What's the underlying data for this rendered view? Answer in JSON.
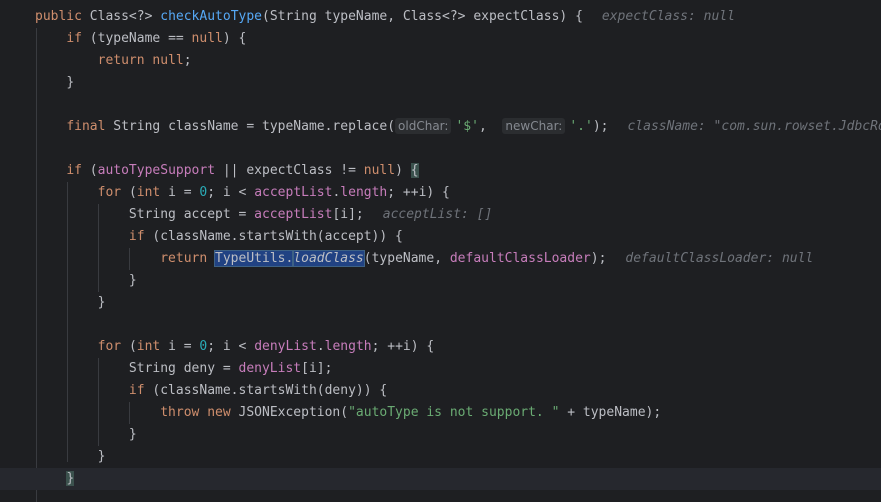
{
  "lines": [
    {
      "indent": "",
      "tokens": [
        {
          "t": "public ",
          "c": "kw"
        },
        {
          "t": "Class<?> ",
          "c": ""
        },
        {
          "t": "checkAutoType",
          "c": "fn"
        },
        {
          "t": "(String typeName, Class<?> expectClass) {",
          "c": ""
        }
      ],
      "hint": "expectClass: null"
    },
    {
      "indent": "    ",
      "tokens": [
        {
          "t": "if ",
          "c": "kw"
        },
        {
          "t": "(typeName == ",
          "c": ""
        },
        {
          "t": "null",
          "c": "kw"
        },
        {
          "t": ") {",
          "c": ""
        }
      ]
    },
    {
      "indent": "        ",
      "tokens": [
        {
          "t": "return null",
          "c": "kw"
        },
        {
          "t": ";",
          "c": ""
        }
      ]
    },
    {
      "indent": "    ",
      "tokens": [
        {
          "t": "}",
          "c": ""
        }
      ]
    },
    {
      "indent": "",
      "tokens": []
    },
    {
      "indent": "    ",
      "tokens": [
        {
          "t": "final ",
          "c": "kw"
        },
        {
          "t": "String className = typeName.replace(",
          "c": ""
        },
        {
          "t": "oldChar:",
          "c": "param"
        },
        {
          "t": "'$'",
          "c": "str"
        },
        {
          "t": ",  ",
          "c": ""
        },
        {
          "t": "newChar:",
          "c": "param"
        },
        {
          "t": "'.'",
          "c": "str"
        },
        {
          "t": ");",
          "c": ""
        }
      ],
      "hint": "className: \"com.sun.rowset.JdbcRowSetImpl\""
    },
    {
      "indent": "",
      "tokens": []
    },
    {
      "indent": "    ",
      "tokens": [
        {
          "t": "if ",
          "c": "kw"
        },
        {
          "t": "(",
          "c": ""
        },
        {
          "t": "autoTypeSupport",
          "c": "fld"
        },
        {
          "t": " || expectClass != ",
          "c": ""
        },
        {
          "t": "null",
          "c": "kw"
        },
        {
          "t": ") ",
          "c": ""
        },
        {
          "t": "{",
          "c": "brace-hl"
        }
      ]
    },
    {
      "indent": "        ",
      "tokens": [
        {
          "t": "for ",
          "c": "kw"
        },
        {
          "t": "(",
          "c": ""
        },
        {
          "t": "int ",
          "c": "kw"
        },
        {
          "t": "i = ",
          "c": ""
        },
        {
          "t": "0",
          "c": "num"
        },
        {
          "t": "; i < ",
          "c": ""
        },
        {
          "t": "acceptList",
          "c": "fld"
        },
        {
          "t": ".",
          "c": ""
        },
        {
          "t": "length",
          "c": "fld"
        },
        {
          "t": "; ++i) {",
          "c": ""
        }
      ]
    },
    {
      "indent": "            ",
      "tokens": [
        {
          "t": "String accept = ",
          "c": ""
        },
        {
          "t": "acceptList",
          "c": "fld"
        },
        {
          "t": "[i];",
          "c": ""
        }
      ],
      "hint": "acceptList: []"
    },
    {
      "indent": "            ",
      "tokens": [
        {
          "t": "if ",
          "c": "kw"
        },
        {
          "t": "(className.startsWith(accept)) {",
          "c": ""
        }
      ]
    },
    {
      "indent": "                ",
      "tokens": [
        {
          "t": "return ",
          "c": "kw"
        },
        {
          "t": "TypeUtils.",
          "c": "sel"
        },
        {
          "t": "loadClass",
          "c": "sel ital"
        },
        {
          "t": "(typeName, ",
          "c": ""
        },
        {
          "t": "defaultClassLoader",
          "c": "fld"
        },
        {
          "t": ");",
          "c": ""
        }
      ],
      "hint": "defaultClassLoader: null"
    },
    {
      "indent": "            ",
      "tokens": [
        {
          "t": "}",
          "c": ""
        }
      ]
    },
    {
      "indent": "        ",
      "tokens": [
        {
          "t": "}",
          "c": ""
        }
      ]
    },
    {
      "indent": "",
      "tokens": []
    },
    {
      "indent": "        ",
      "tokens": [
        {
          "t": "for ",
          "c": "kw"
        },
        {
          "t": "(",
          "c": ""
        },
        {
          "t": "int ",
          "c": "kw"
        },
        {
          "t": "i = ",
          "c": ""
        },
        {
          "t": "0",
          "c": "num"
        },
        {
          "t": "; i < ",
          "c": ""
        },
        {
          "t": "denyList",
          "c": "fld"
        },
        {
          "t": ".",
          "c": ""
        },
        {
          "t": "length",
          "c": "fld"
        },
        {
          "t": "; ++i) {",
          "c": ""
        }
      ]
    },
    {
      "indent": "            ",
      "tokens": [
        {
          "t": "String deny = ",
          "c": ""
        },
        {
          "t": "denyList",
          "c": "fld"
        },
        {
          "t": "[i];",
          "c": ""
        }
      ]
    },
    {
      "indent": "            ",
      "tokens": [
        {
          "t": "if ",
          "c": "kw"
        },
        {
          "t": "(className.startsWith(deny)) {",
          "c": ""
        }
      ]
    },
    {
      "indent": "                ",
      "tokens": [
        {
          "t": "throw new ",
          "c": "kw"
        },
        {
          "t": "JSONException(",
          "c": ""
        },
        {
          "t": "\"autoType is not support. \"",
          "c": "str"
        },
        {
          "t": " + typeName);",
          "c": ""
        }
      ]
    },
    {
      "indent": "            ",
      "tokens": [
        {
          "t": "}",
          "c": ""
        }
      ]
    },
    {
      "indent": "        ",
      "tokens": [
        {
          "t": "}",
          "c": ""
        }
      ]
    },
    {
      "indent": "    ",
      "tokens": [
        {
          "t": "}",
          "c": "brace-hl"
        }
      ],
      "current": true
    }
  ]
}
